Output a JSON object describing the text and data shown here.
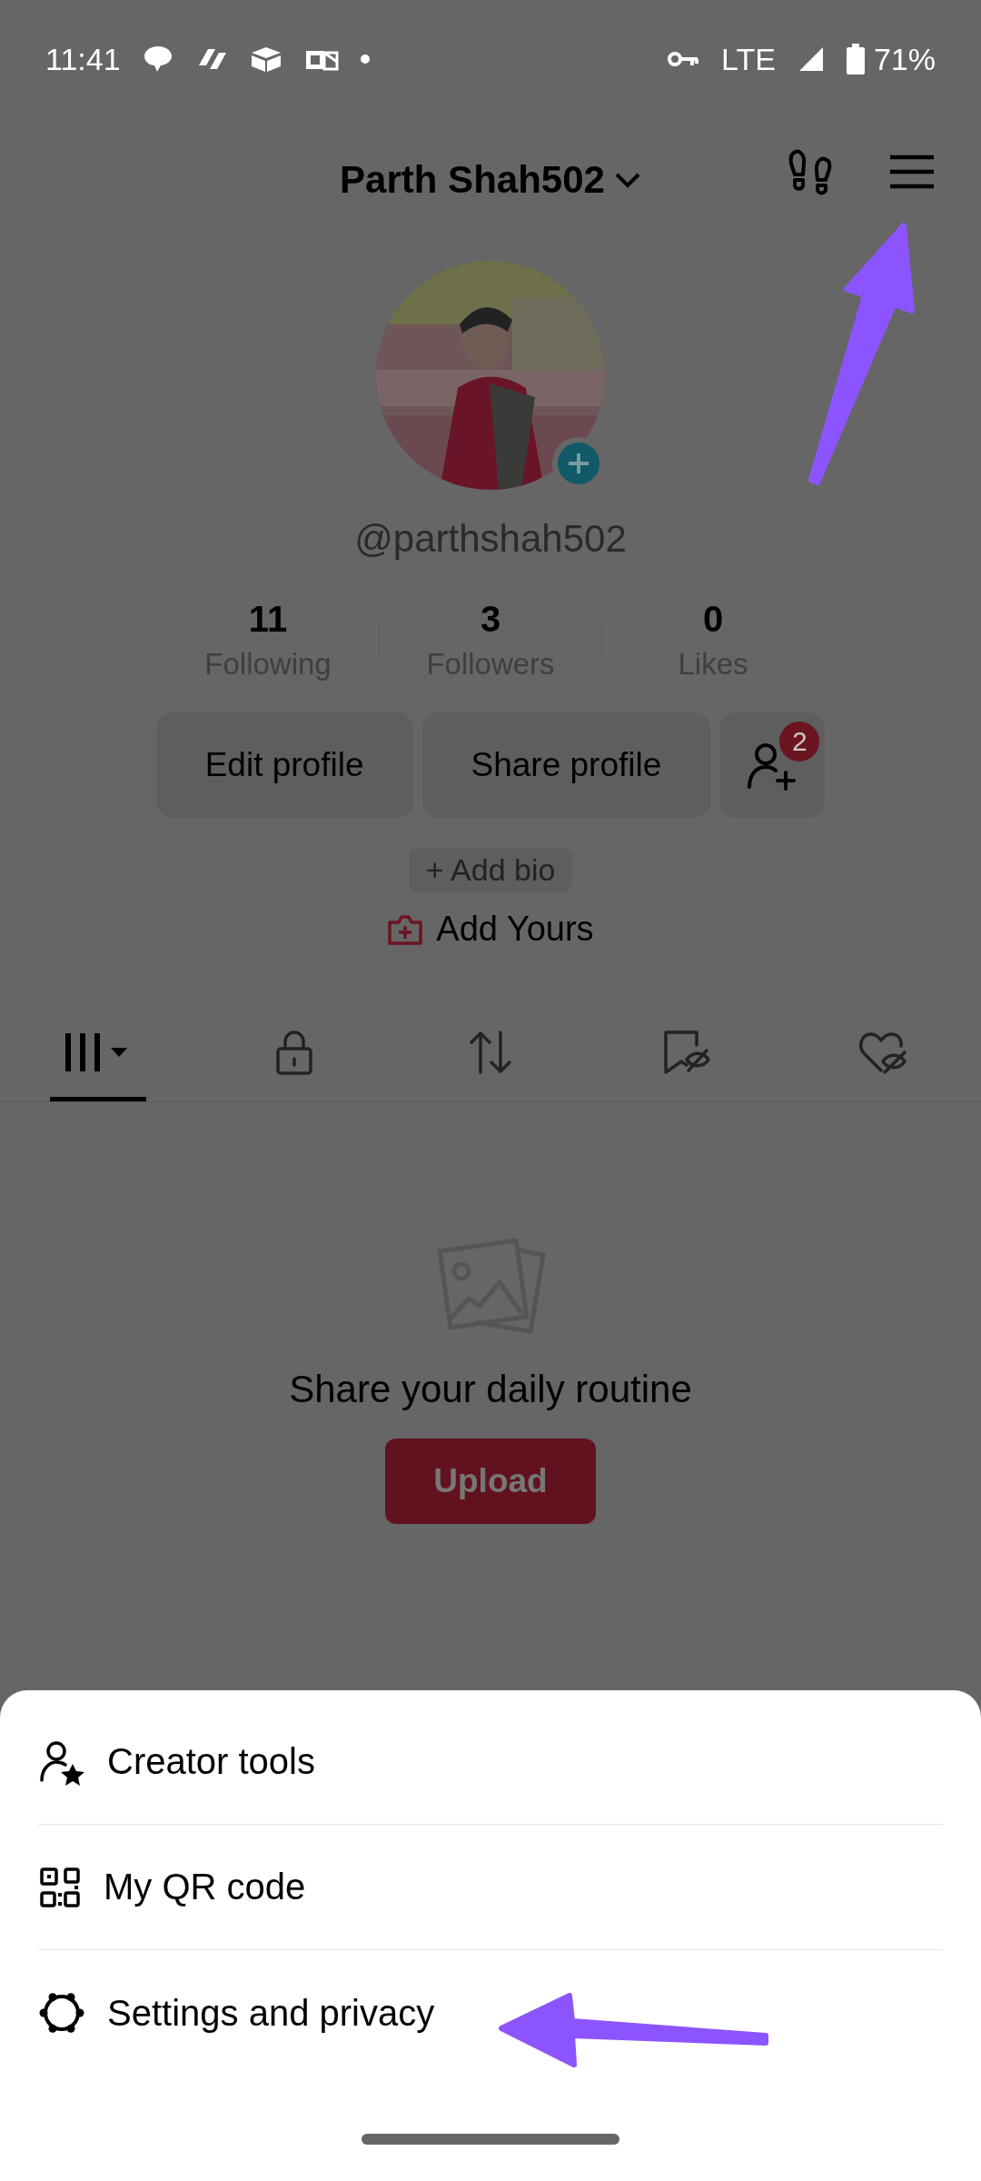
{
  "status_bar": {
    "time": "11:41",
    "network": "LTE",
    "battery": "71%"
  },
  "header": {
    "username": "Parth Shah502"
  },
  "profile": {
    "handle": "@parthshah502",
    "notification_count": "2"
  },
  "stats": [
    {
      "value": "11",
      "label": "Following"
    },
    {
      "value": "3",
      "label": "Followers"
    },
    {
      "value": "0",
      "label": "Likes"
    }
  ],
  "actions": [
    "Edit profile",
    "Share profile"
  ],
  "add_bio": "+ Add bio",
  "add_yours": "Add Yours",
  "tabs": [
    {
      "kind": "grid",
      "selected": true
    },
    {
      "kind": "lock",
      "selected": false
    },
    {
      "kind": "repost",
      "selected": false
    },
    {
      "kind": "saved",
      "selected": false
    },
    {
      "kind": "liked",
      "selected": false
    }
  ],
  "empty_state": {
    "message": "Share your daily routine",
    "button": "Upload"
  },
  "menu": [
    {
      "kind": "creator",
      "label": "Creator tools"
    },
    {
      "kind": "qr",
      "label": "My QR code"
    },
    {
      "kind": "settings",
      "label": "Settings and privacy"
    }
  ]
}
